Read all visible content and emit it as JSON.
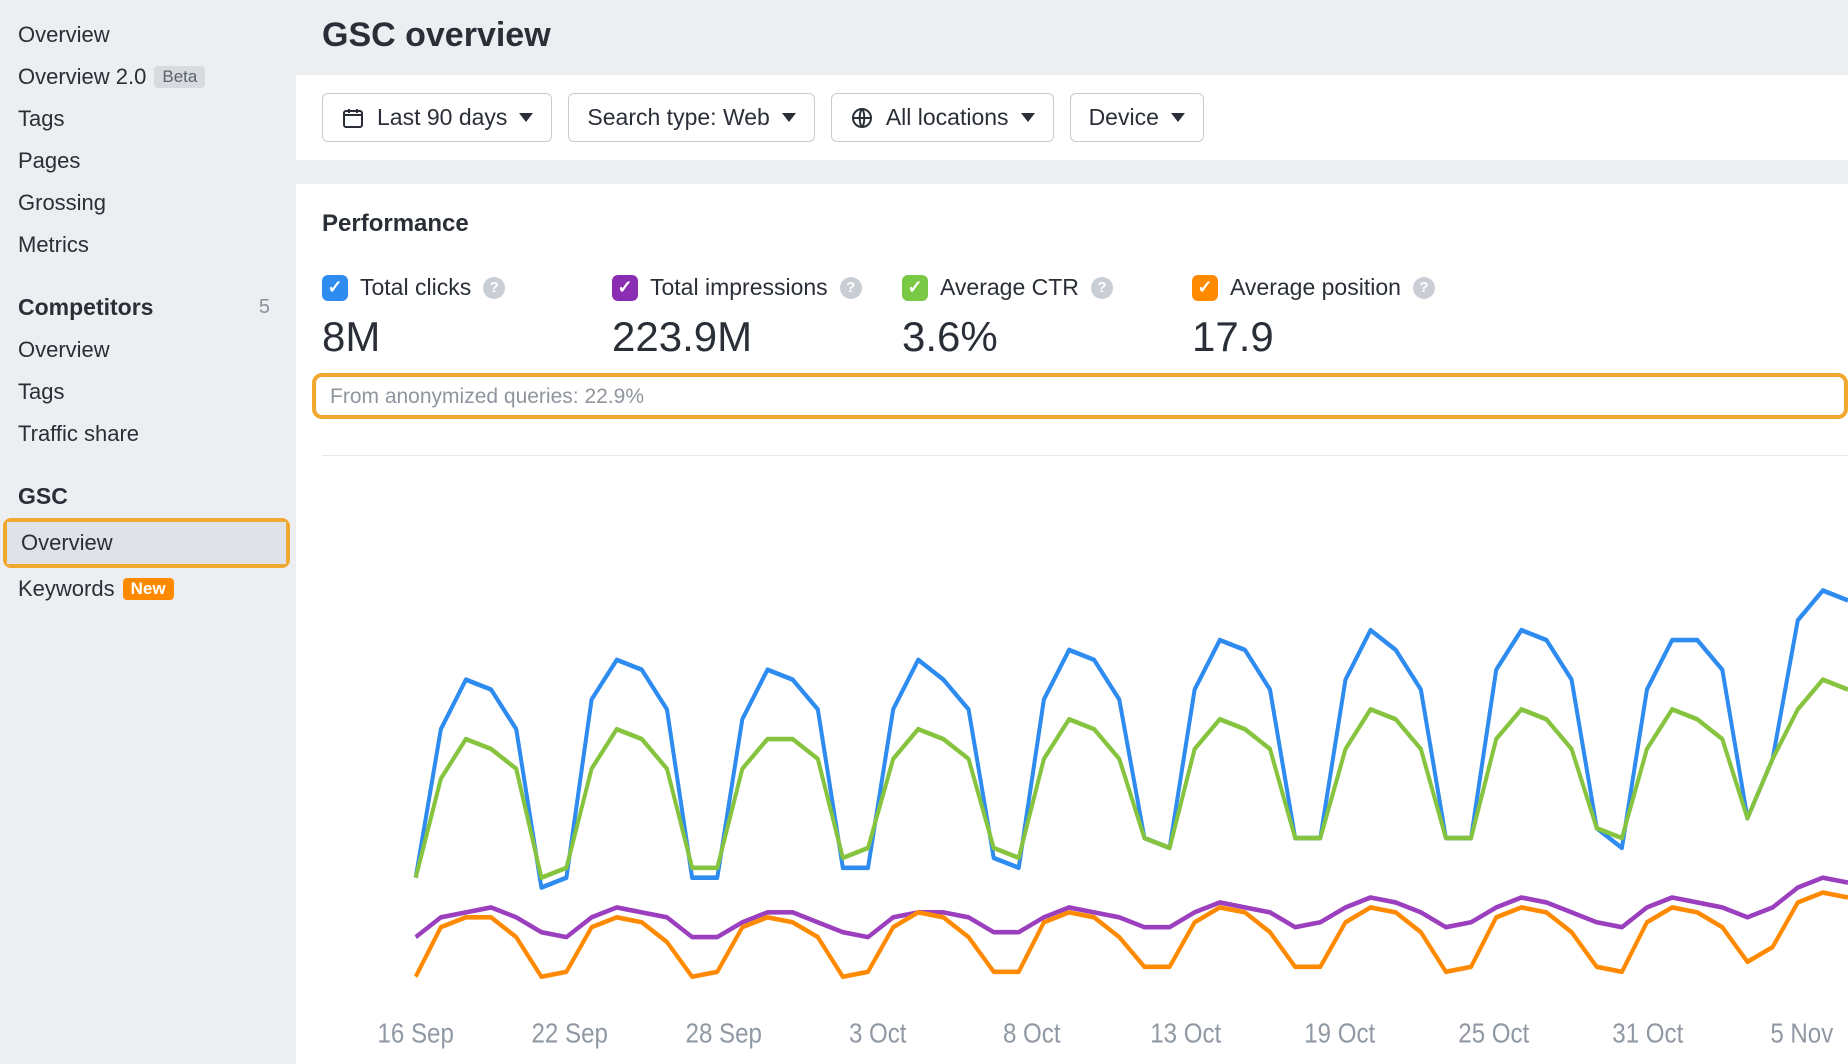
{
  "sidebar": {
    "top_items": [
      {
        "label": "Overview",
        "badge": null
      },
      {
        "label": "Overview 2.0",
        "badge": "Beta"
      },
      {
        "label": "Tags",
        "badge": null
      },
      {
        "label": "Pages",
        "badge": null
      },
      {
        "label": "Grossing",
        "badge": null
      },
      {
        "label": "Metrics",
        "badge": null
      }
    ],
    "competitors": {
      "title": "Competitors",
      "count": "5",
      "items": [
        {
          "label": "Overview"
        },
        {
          "label": "Tags"
        },
        {
          "label": "Traffic share"
        }
      ]
    },
    "gsc": {
      "title": "GSC",
      "items": [
        {
          "label": "Overview",
          "badge": null,
          "selected": true,
          "highlight": true
        },
        {
          "label": "Keywords",
          "badge": "New"
        }
      ]
    }
  },
  "header": {
    "title": "GSC overview"
  },
  "filters": {
    "date": "Last 90 days",
    "search_type": "Search type: Web",
    "locations": "All locations",
    "device": "Device"
  },
  "panel": {
    "title": "Performance",
    "metrics": [
      {
        "name": "total-clicks",
        "label": "Total clicks",
        "value": "8M",
        "color": "blue"
      },
      {
        "name": "total-impressions",
        "label": "Total impressions",
        "value": "223.9M",
        "color": "purple"
      },
      {
        "name": "average-ctr",
        "label": "Average CTR",
        "value": "3.6%",
        "color": "green"
      },
      {
        "name": "average-position",
        "label": "Average position",
        "value": "17.9",
        "color": "orange"
      }
    ],
    "anonymized_note": "From anonymized queries: 22.9%"
  },
  "chart_data": {
    "type": "line",
    "xlabel": "",
    "ylabel": "",
    "x_ticks": [
      "16 Sep",
      "22 Sep",
      "28 Sep",
      "3 Oct",
      "8 Oct",
      "13 Oct",
      "19 Oct",
      "25 Oct",
      "31 Oct",
      "5 Nov"
    ],
    "note": "Values are unlabeled on the y-axis; series are normalized 0-100 relative to their chart height.",
    "series": [
      {
        "name": "Total clicks",
        "color": "#2e8bf0",
        "values": [
          22,
          52,
          62,
          60,
          52,
          20,
          22,
          58,
          66,
          64,
          56,
          22,
          22,
          54,
          64,
          62,
          56,
          24,
          24,
          56,
          66,
          62,
          56,
          26,
          24,
          58,
          68,
          66,
          58,
          30,
          28,
          60,
          70,
          68,
          60,
          30,
          30,
          62,
          72,
          68,
          60,
          30,
          30,
          64,
          72,
          70,
          62,
          32,
          28,
          60,
          70,
          70,
          64,
          34,
          46,
          74,
          80,
          78
        ]
      },
      {
        "name": "Average CTR",
        "color": "#86c440",
        "values": [
          22,
          42,
          50,
          48,
          44,
          22,
          24,
          44,
          52,
          50,
          44,
          24,
          24,
          44,
          50,
          50,
          46,
          26,
          28,
          46,
          52,
          50,
          46,
          28,
          26,
          46,
          54,
          52,
          46,
          30,
          28,
          48,
          54,
          52,
          48,
          30,
          30,
          48,
          56,
          54,
          48,
          30,
          30,
          50,
          56,
          54,
          48,
          32,
          30,
          48,
          56,
          54,
          50,
          34,
          46,
          56,
          62,
          60
        ]
      },
      {
        "name": "Total impressions",
        "color": "#9b3fbf",
        "values": [
          10,
          14,
          15,
          16,
          14,
          11,
          10,
          14,
          16,
          15,
          14,
          10,
          10,
          13,
          15,
          15,
          13,
          11,
          10,
          14,
          15,
          15,
          14,
          11,
          11,
          14,
          16,
          15,
          14,
          12,
          12,
          15,
          17,
          16,
          15,
          12,
          13,
          16,
          18,
          17,
          15,
          12,
          13,
          16,
          18,
          17,
          15,
          13,
          12,
          16,
          18,
          17,
          16,
          14,
          16,
          20,
          22,
          21
        ]
      },
      {
        "name": "Average position",
        "color": "#ff8a00",
        "values": [
          2,
          12,
          14,
          14,
          10,
          2,
          3,
          12,
          14,
          13,
          9,
          2,
          3,
          12,
          14,
          13,
          10,
          2,
          3,
          12,
          15,
          14,
          10,
          3,
          3,
          13,
          15,
          14,
          10,
          4,
          4,
          13,
          16,
          15,
          11,
          4,
          4,
          13,
          16,
          15,
          11,
          3,
          4,
          14,
          16,
          15,
          11,
          4,
          3,
          13,
          16,
          15,
          12,
          5,
          8,
          17,
          19,
          18
        ]
      }
    ]
  }
}
